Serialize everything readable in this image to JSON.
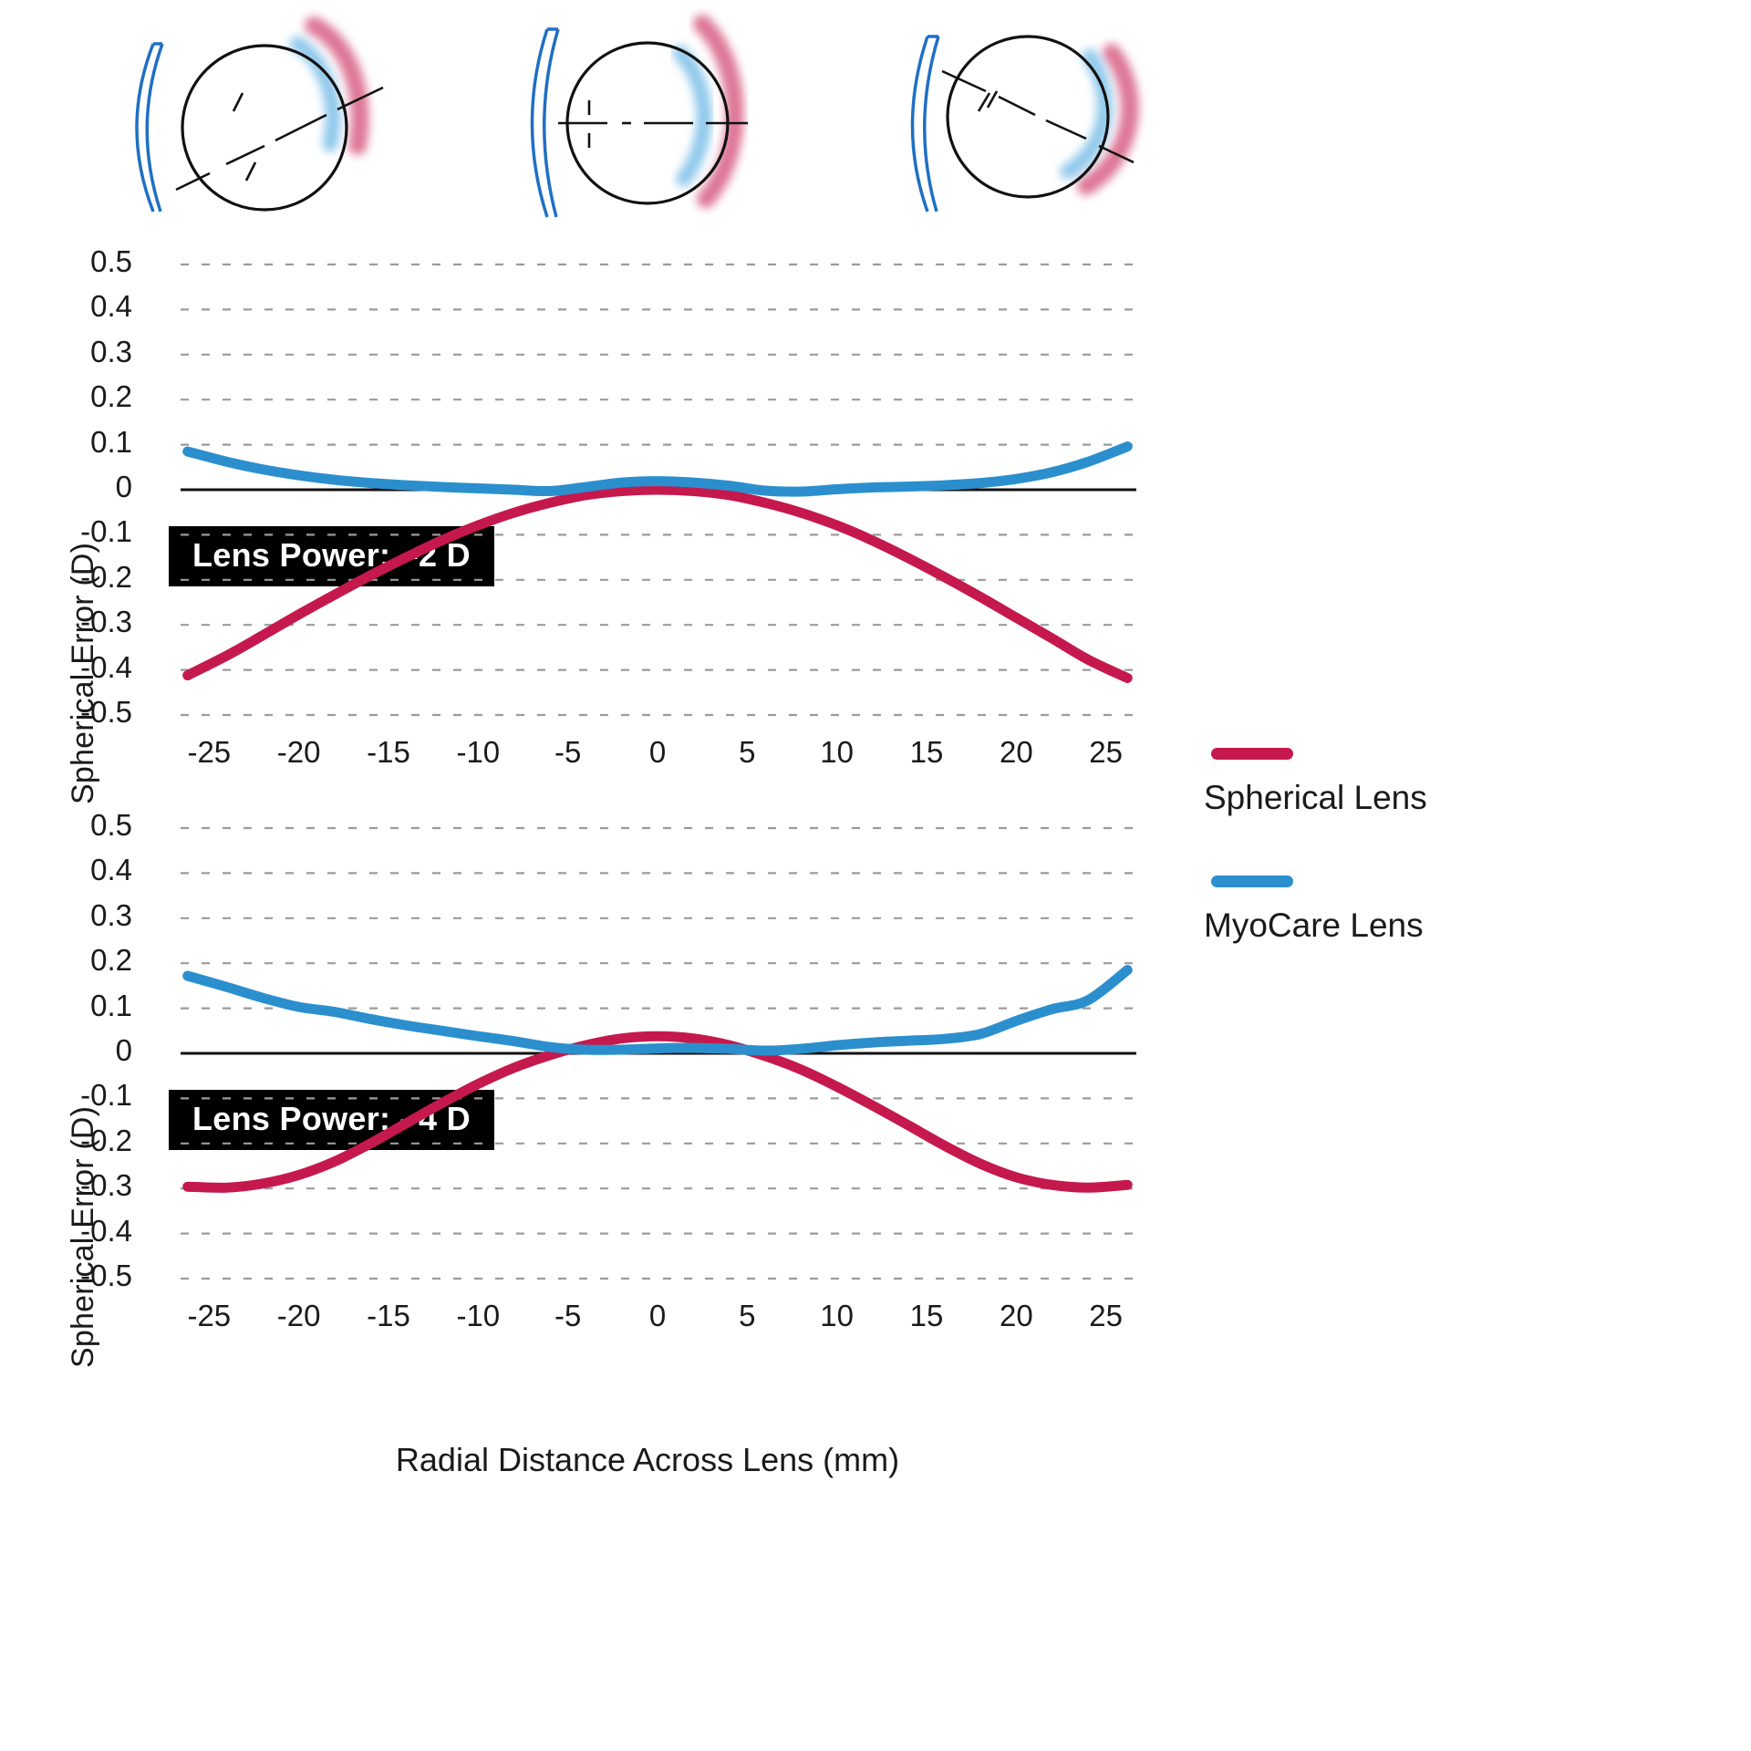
{
  "figure": {
    "x_axis_title": "Radial Distance Across Lens (mm)",
    "y_axis_title": "Spherical Error (D)"
  },
  "legend": {
    "position": "right",
    "entries": [
      {
        "label": "Spherical Lens",
        "color": "#c5194e",
        "swatch": "line-swatch-spherical"
      },
      {
        "label": "MyoCare Lens",
        "color": "#2b8fce",
        "swatch": "line-swatch-myocare"
      }
    ]
  },
  "eye_diagrams": [
    {
      "name": "oblique-gaze-left",
      "lens_color": "#1f6fc4",
      "myocare_focus_color": "#63b3e4",
      "spherical_focus_color": "#d0436e",
      "globe_color": "#111111"
    },
    {
      "name": "straight-gaze-center",
      "lens_color": "#1f6fc4",
      "myocare_focus_color": "#63b3e4",
      "spherical_focus_color": "#d0436e",
      "globe_color": "#111111"
    },
    {
      "name": "oblique-gaze-right",
      "lens_color": "#1f6fc4",
      "myocare_focus_color": "#63b3e4",
      "spherical_focus_color": "#d0436e",
      "globe_color": "#111111"
    }
  ],
  "chart_data": [
    {
      "type": "line",
      "title": "Lens Power: –2 D",
      "panel_label": "Lens Power: –2 D",
      "xlabel": "Radial Distance Across Lens (mm)",
      "ylabel": "Spherical Error (D)",
      "xlim": [
        -27,
        27
      ],
      "ylim": [
        -0.5,
        0.5
      ],
      "xticks": [
        -25,
        -20,
        -15,
        -10,
        -5,
        0,
        5,
        10,
        15,
        20,
        25
      ],
      "xtick_labels": [
        "-25",
        "-20",
        "-15",
        "-10",
        "-5",
        "0",
        "5",
        "10",
        "15",
        "20",
        "25"
      ],
      "yticks": [
        0.5,
        0.4,
        0.3,
        0.2,
        0.1,
        0,
        -0.1,
        -0.2,
        -0.3,
        -0.4,
        -0.5
      ],
      "ytick_labels": [
        "0.5",
        "0.4",
        "0.3",
        "0.2",
        "0.1",
        "0",
        "-0.1",
        "-0.2",
        "-0.3",
        "-0.4",
        "-0.5"
      ],
      "grid": true,
      "x": [
        -26.2,
        -24,
        -22,
        -20,
        -18,
        -16,
        -14,
        -12,
        -10,
        -8,
        -6,
        -4,
        -2,
        0,
        2,
        4,
        6,
        8,
        10,
        12,
        14,
        16,
        18,
        20,
        22,
        24,
        26.2
      ],
      "series": [
        {
          "name": "Spherical Lens",
          "color": "#c5194e",
          "values": [
            -0.412,
            -0.368,
            -0.323,
            -0.277,
            -0.233,
            -0.19,
            -0.15,
            -0.112,
            -0.079,
            -0.051,
            -0.029,
            -0.012,
            -0.003,
            0.0,
            -0.003,
            -0.012,
            -0.029,
            -0.051,
            -0.079,
            -0.113,
            -0.152,
            -0.194,
            -0.238,
            -0.284,
            -0.33,
            -0.377,
            -0.418
          ]
        },
        {
          "name": "MyoCare Lens",
          "color": "#2b8fce",
          "values": [
            0.085,
            0.062,
            0.045,
            0.032,
            0.022,
            0.015,
            0.01,
            0.006,
            0.003,
            0.0,
            -0.003,
            0.006,
            0.016,
            0.019,
            0.016,
            0.009,
            -0.002,
            -0.004,
            0.001,
            0.005,
            0.007,
            0.01,
            0.015,
            0.024,
            0.039,
            0.062,
            0.096
          ]
        }
      ]
    },
    {
      "type": "line",
      "title": "Lens Power: –4 D",
      "panel_label": "Lens Power: –4 D",
      "xlabel": "Radial Distance Across Lens (mm)",
      "ylabel": "Spherical Error (D)",
      "xlim": [
        -27,
        27
      ],
      "ylim": [
        -0.5,
        0.5
      ],
      "xticks": [
        -25,
        -20,
        -15,
        -10,
        -5,
        0,
        5,
        10,
        15,
        20,
        25
      ],
      "xtick_labels": [
        "-25",
        "-20",
        "-15",
        "-10",
        "-5",
        "0",
        "5",
        "10",
        "15",
        "20",
        "25"
      ],
      "yticks": [
        0.5,
        0.4,
        0.3,
        0.2,
        0.1,
        0,
        -0.1,
        -0.2,
        -0.3,
        -0.4,
        -0.5
      ],
      "ytick_labels": [
        "0.5",
        "0.4",
        "0.3",
        "0.2",
        "0.1",
        "0",
        "-0.1",
        "-0.2",
        "-0.3",
        "-0.4",
        "-0.5"
      ],
      "grid": true,
      "x": [
        -26.2,
        -24,
        -22,
        -20,
        -18,
        -16,
        -14,
        -12,
        -10,
        -8,
        -6,
        -4,
        -2,
        0,
        2,
        4,
        6,
        8,
        10,
        12,
        14,
        16,
        18,
        20,
        22,
        24,
        26.2
      ],
      "series": [
        {
          "name": "Spherical Lens",
          "color": "#c5194e",
          "values": [
            -0.296,
            -0.298,
            -0.289,
            -0.27,
            -0.24,
            -0.2,
            -0.155,
            -0.11,
            -0.068,
            -0.032,
            -0.004,
            0.018,
            0.033,
            0.038,
            0.033,
            0.018,
            -0.006,
            -0.036,
            -0.074,
            -0.116,
            -0.16,
            -0.205,
            -0.245,
            -0.275,
            -0.292,
            -0.298,
            -0.292
          ]
        },
        {
          "name": "MyoCare Lens",
          "color": "#2b8fce",
          "values": [
            0.172,
            0.147,
            0.123,
            0.103,
            0.092,
            0.076,
            0.062,
            0.05,
            0.038,
            0.027,
            0.014,
            0.008,
            0.008,
            0.011,
            0.012,
            0.01,
            0.006,
            0.01,
            0.018,
            0.024,
            0.028,
            0.032,
            0.043,
            0.072,
            0.098,
            0.118,
            0.185
          ]
        }
      ]
    }
  ]
}
